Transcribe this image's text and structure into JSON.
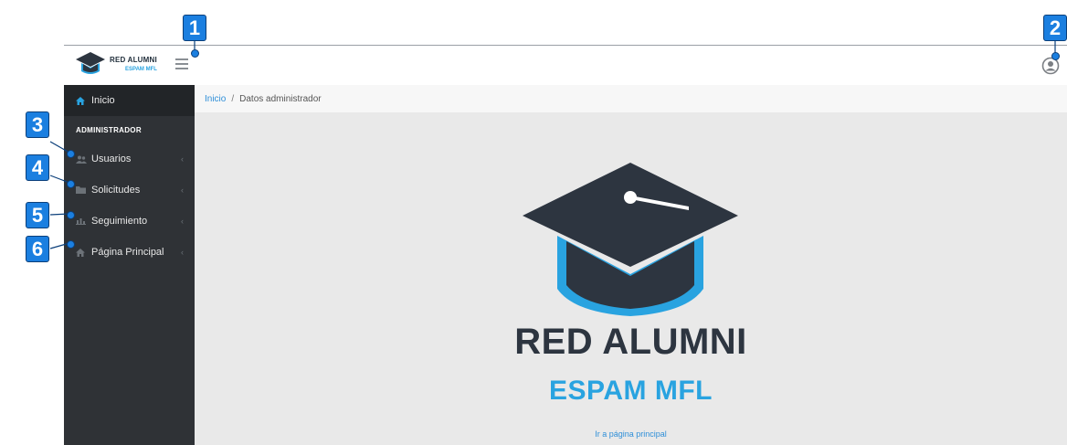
{
  "brand": {
    "title": "RED ALUMNI",
    "subtitle": "ESPAM MFL"
  },
  "header": {
    "menu_icon": "hamburger-icon",
    "user_icon": "user-circle-icon"
  },
  "sidebar": {
    "home": {
      "label": "Inicio",
      "icon": "home-icon"
    },
    "section_title": "ADMINISTRADOR",
    "items": [
      {
        "label": "Usuarios",
        "icon": "users-icon"
      },
      {
        "label": "Solicitudes",
        "icon": "folder-icon"
      },
      {
        "label": "Seguimiento",
        "icon": "chart-icon"
      },
      {
        "label": "Página Principal",
        "icon": "home-icon"
      }
    ]
  },
  "breadcrumb": {
    "link": "Inicio",
    "separator": "/",
    "current": "Datos administrador"
  },
  "main": {
    "logo_title": "RED ALUMNI",
    "logo_subtitle": "ESPAM MFL",
    "home_link": "Ir a página principal"
  },
  "callouts": [
    "1",
    "2",
    "3",
    "4",
    "5",
    "6"
  ],
  "colors": {
    "sidebar": "#2f3236",
    "accent": "#29a3e0",
    "dark": "#2d3540",
    "callout": "#1b7fe0"
  }
}
